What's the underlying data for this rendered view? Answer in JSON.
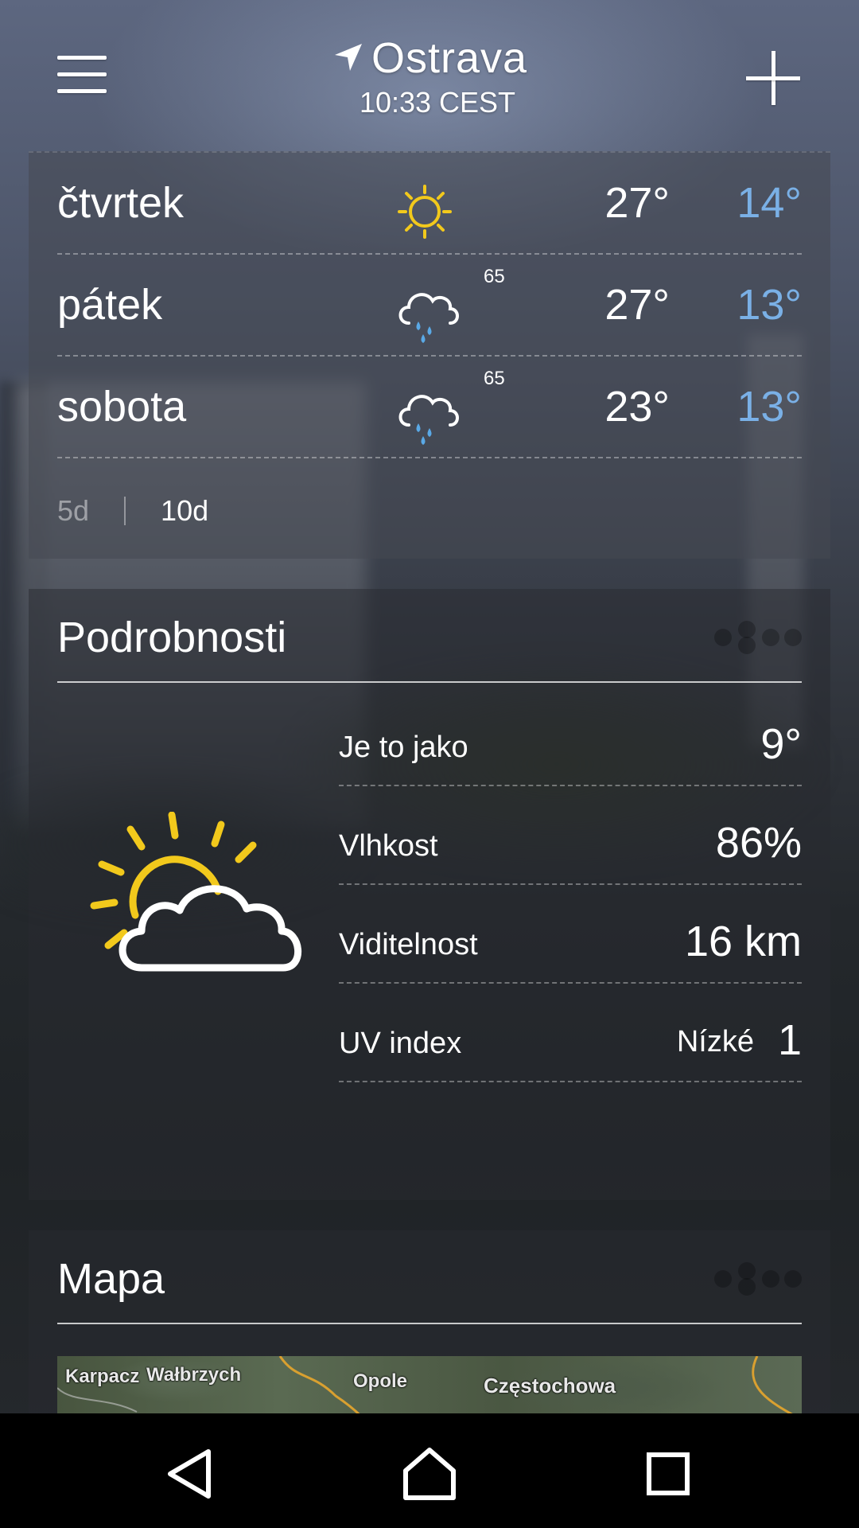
{
  "header": {
    "city": "Ostrava",
    "time": "10:33 CEST"
  },
  "forecast": {
    "days": [
      {
        "day": "čtvrtek",
        "icon": "sun-icon",
        "precip": "",
        "high": "27°",
        "low": "14°"
      },
      {
        "day": "pátek",
        "icon": "rain-cloud-icon",
        "precip": "65",
        "high": "27°",
        "low": "13°"
      },
      {
        "day": "sobota",
        "icon": "rain-cloud-icon",
        "precip": "65",
        "high": "23°",
        "low": "13°"
      }
    ],
    "tabs": {
      "five_day": "5d",
      "ten_day": "10d"
    },
    "colors": {
      "low_temp": "#7ab0e6",
      "sun": "#f2c91c",
      "rain": "#5aa9e6"
    }
  },
  "details": {
    "title": "Podrobnosti",
    "icon": "partly-cloudy-icon",
    "rows": [
      {
        "label": "Je to jako",
        "value": "9°",
        "sub": ""
      },
      {
        "label": "Vlhkost",
        "value": "86%",
        "sub": ""
      },
      {
        "label": "Viditelnost",
        "value": "16 km",
        "sub": ""
      },
      {
        "label": "UV index",
        "value": "1",
        "sub": "Nízké"
      }
    ]
  },
  "map": {
    "title": "Mapa",
    "labels": [
      "Karpacz",
      "Wałbrzych",
      "Opole",
      "Częstochowa"
    ]
  },
  "navbar": {
    "icons": [
      "back-icon",
      "home-icon",
      "recents-icon"
    ]
  }
}
